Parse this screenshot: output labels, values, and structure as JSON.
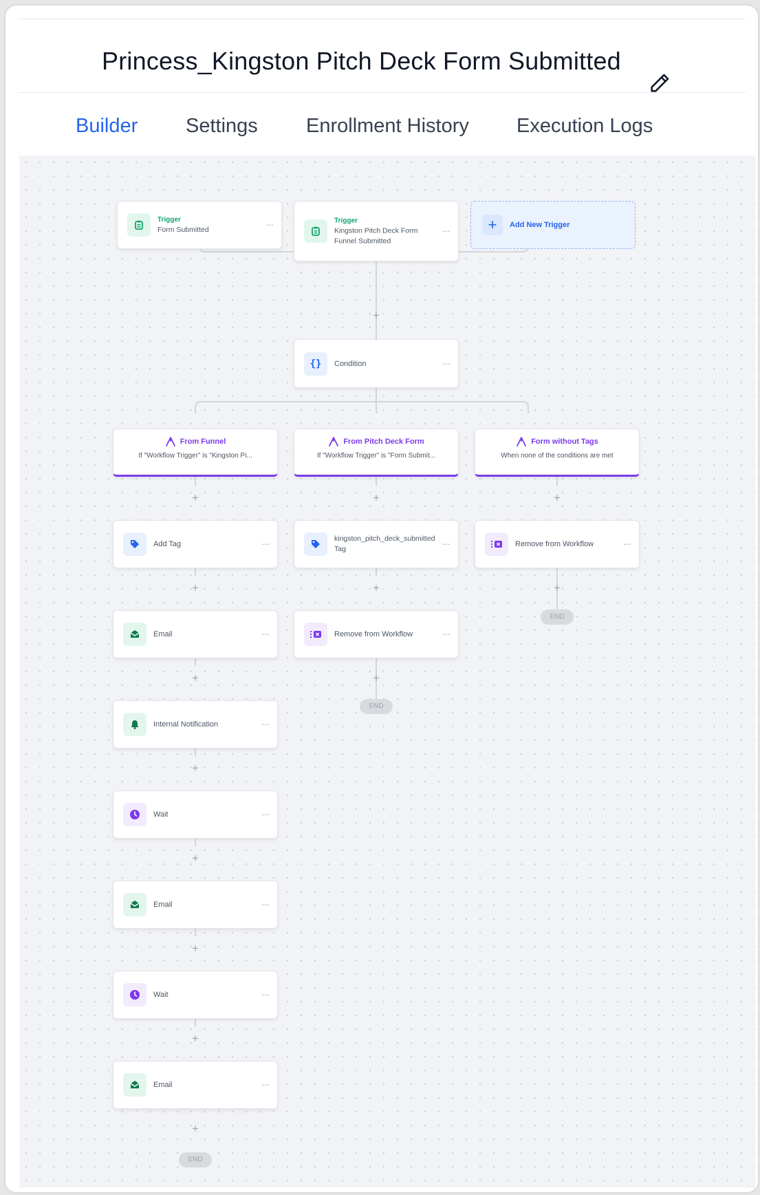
{
  "workflow": {
    "title": "Princess_Kingston Pitch Deck Form Submitted"
  },
  "tabs": [
    {
      "label": "Builder",
      "active": true
    },
    {
      "label": "Settings",
      "active": false
    },
    {
      "label": "Enrollment History",
      "active": false
    },
    {
      "label": "Execution Logs",
      "active": false
    }
  ],
  "triggers": [
    {
      "heading": "Trigger",
      "label": "Form Submitted"
    },
    {
      "heading": "Trigger",
      "label": "Kingston Pitch Deck Form Funnel Submitted"
    }
  ],
  "add_trigger": {
    "label": "Add New Trigger"
  },
  "condition": {
    "label": "Condition"
  },
  "branches": [
    {
      "title": "From Funnel",
      "subtitle": "If \"Workflow Trigger\" is \"Kingston Pi..."
    },
    {
      "title": "From Pitch Deck Form",
      "subtitle": "If \"Workflow Trigger\" is \"Form Submit..."
    },
    {
      "title": "Form without Tags",
      "subtitle": "When none of the conditions are met"
    }
  ],
  "branch1_actions": [
    {
      "label": "Add Tag",
      "icon": "tag-icon"
    },
    {
      "label": "Email",
      "icon": "envelope-icon"
    },
    {
      "label": "Internal Notification",
      "icon": "bell-icon"
    },
    {
      "label": "Wait",
      "icon": "clock-icon"
    },
    {
      "label": "Email",
      "icon": "envelope-icon"
    },
    {
      "label": "Wait",
      "icon": "clock-icon"
    },
    {
      "label": "Email",
      "icon": "envelope-icon"
    }
  ],
  "branch2_actions": [
    {
      "label": "kingston_pitch_deck_submitted Tag",
      "icon": "tag-icon"
    },
    {
      "label": "Remove from Workflow",
      "icon": "remove-workflow-icon"
    }
  ],
  "branch3_actions": [
    {
      "label": "Remove from Workflow",
      "icon": "remove-workflow-icon"
    }
  ],
  "end_label": "END",
  "more_glyph": "···",
  "plus_glyph": "+",
  "colors": {
    "accent": "#2563eb",
    "branch": "#7c3aed",
    "trigger": "#10a46e",
    "wait": "#7c3aed",
    "canvas": "#f2f3f6"
  }
}
